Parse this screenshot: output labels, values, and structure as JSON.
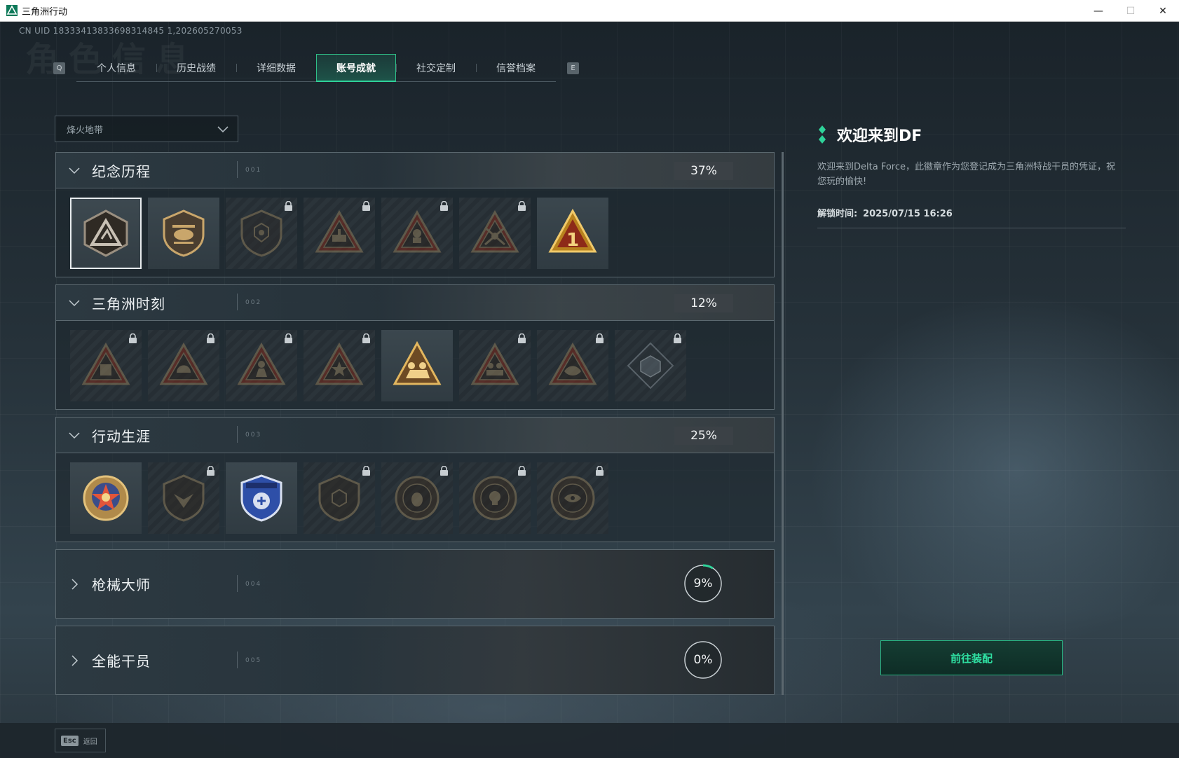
{
  "window": {
    "title": "三角洲行动",
    "minimize": "—",
    "maximize": "☐",
    "close": "✕"
  },
  "uid": "CN UID 18333413833698314845 1,202605270053",
  "tabs": {
    "left_key": "Q",
    "right_key": "E",
    "items": [
      {
        "label": "个人信息"
      },
      {
        "label": "历史战绩"
      },
      {
        "label": "详细数据"
      },
      {
        "label": "账号成就",
        "active": true
      },
      {
        "label": "社交定制"
      },
      {
        "label": "信誉档案"
      }
    ]
  },
  "mode_select": {
    "value": "烽火地带"
  },
  "sections": [
    {
      "title": "纪念历程",
      "index": "001",
      "progress": "37%",
      "expanded": true,
      "badges": [
        {
          "icon": "delta-emblem-icon",
          "locked": false,
          "selected": true
        },
        {
          "icon": "helicopter-emblem-icon",
          "locked": false
        },
        {
          "icon": "shield-emblem-icon",
          "locked": true
        },
        {
          "icon": "tank-emblem-icon",
          "locked": true
        },
        {
          "icon": "operator-emblem-icon",
          "locked": true
        },
        {
          "icon": "crossed-rifles-emblem-icon",
          "locked": true
        },
        {
          "icon": "rank-one-emblem-icon",
          "locked": false
        }
      ]
    },
    {
      "title": "三角洲时刻",
      "index": "002",
      "progress": "12%",
      "expanded": true,
      "badges": [
        {
          "icon": "crate-emblem-icon",
          "locked": true
        },
        {
          "icon": "helmet-emblem-icon",
          "locked": true
        },
        {
          "icon": "soldier-emblem-icon",
          "locked": true
        },
        {
          "icon": "star-emblem-icon",
          "locked": true
        },
        {
          "icon": "squad-emblem-icon",
          "locked": false
        },
        {
          "icon": "team-emblem-icon",
          "locked": true
        },
        {
          "icon": "fish-emblem-icon",
          "locked": true
        },
        {
          "icon": "cube-emblem-icon",
          "locked": true
        }
      ]
    },
    {
      "title": "行动生涯",
      "index": "003",
      "progress": "25%",
      "expanded": true,
      "badges": [
        {
          "icon": "star-medal-icon",
          "locked": false
        },
        {
          "icon": "wing-shield-icon",
          "locked": true
        },
        {
          "icon": "police-shield-icon",
          "locked": false
        },
        {
          "icon": "hex-shield-icon",
          "locked": true
        },
        {
          "icon": "mask-medal-icon",
          "locked": true
        },
        {
          "icon": "skull-medal-icon",
          "locked": true
        },
        {
          "icon": "eye-medal-icon",
          "locked": true
        }
      ]
    },
    {
      "title": "枪械大师",
      "index": "004",
      "progress": "9%",
      "progress_value": 0.09,
      "expanded": false
    },
    {
      "title": "全能干员",
      "index": "005",
      "progress": "0%",
      "progress_value": 0.0,
      "expanded": false
    }
  ],
  "info": {
    "title": "欢迎来到DF",
    "description": "欢迎来到Delta Force，此徽章作为您登记成为三角洲特战干员的凭证，祝您玩的愉快!",
    "unlock_label": "解锁时间:",
    "unlock_time": "2025/07/15 16:26"
  },
  "equip_button": "前往装配",
  "esc": {
    "key": "Esc",
    "label": "返回"
  },
  "colors": {
    "accent": "#2fd39a",
    "panel_border": "#5c6970"
  }
}
